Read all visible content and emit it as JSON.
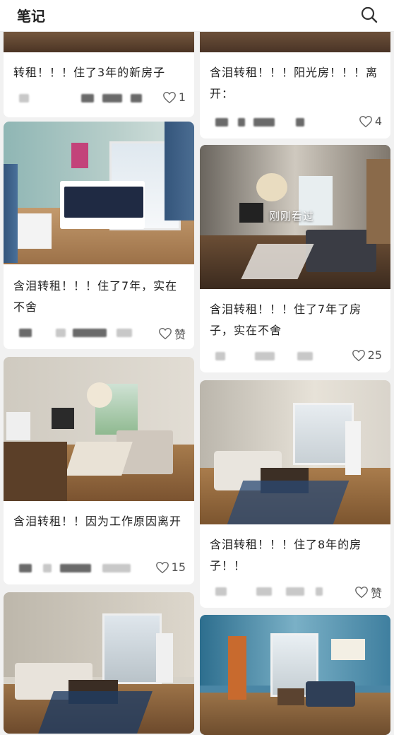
{
  "header": {
    "title": "笔记",
    "search_icon": "search-icon"
  },
  "cards": [
    {
      "title": "转租！！！住了3年的新房子",
      "likes": "1"
    },
    {
      "title": "含泪转租！！！阳光房！！！离开：",
      "likes": "4"
    },
    {
      "title": "含泪转租！！！住了7年，实在不舍",
      "likes": "赞"
    },
    {
      "title": "含泪转租！！！住了7年了房子，实在不舍",
      "likes": "25",
      "badge": "刚刚看过"
    },
    {
      "title": "含泪转租！！因为工作原因离开",
      "likes": "15"
    },
    {
      "title": "含泪转租！！！住了8年的房子！！",
      "likes": "赞"
    }
  ],
  "colors": {
    "accent": "#222222",
    "heart": "#666666"
  }
}
